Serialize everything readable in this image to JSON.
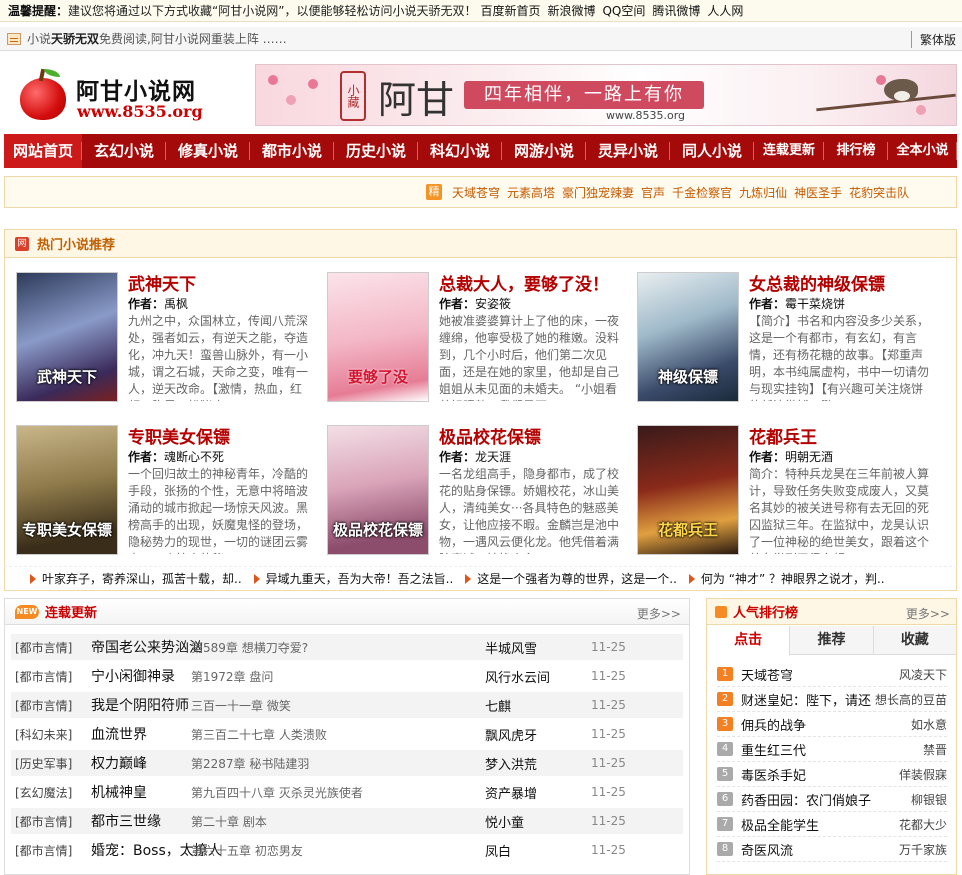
{
  "topbar": {
    "label": "温馨提醒：",
    "text": "建议您将通过以下方式收藏“阿甘小说网”，以便能够轻松访问小说天骄无双！",
    "links": [
      "百度新首页",
      "新浪微博",
      "QQ空间",
      "腾讯微博",
      "人人网"
    ]
  },
  "notice": {
    "prefix": "小说",
    "title": "天骄无双",
    "suffix": "免费阅读,阿甘小说网重装上阵 ……",
    "traditional": "繁体版"
  },
  "header": {
    "site_name": "阿甘小说网",
    "site_url": "www.8535.org",
    "banner_seal": "小藏",
    "banner_big": "阿甘",
    "banner_slogan": "四年相伴，一路上有你",
    "banner_url": "www.8535.org"
  },
  "nav": {
    "items": [
      "网站首页",
      "玄幻小说",
      "修真小说",
      "都市小说",
      "历史小说",
      "科幻小说",
      "网游小说",
      "灵异小说",
      "同人小说",
      "连载更新",
      "排行榜",
      "全本小说"
    ]
  },
  "hotbar": {
    "badge": "精",
    "keywords": [
      "天域苍穹",
      "元素高塔",
      "豪门独宠辣妻",
      "官声",
      "千金检察官",
      "九炼归仙",
      "神医圣手",
      "花豹突击队"
    ]
  },
  "recommend": {
    "title": "热门小说推荐",
    "author_label": "作者：",
    "books": [
      {
        "name": "武神天下",
        "author": "禹枫",
        "cover": "武神天下",
        "desc": "九州之中，众国林立，传闻八荒深处，强者如云，有逆天之能，夺造化，冲九天！蛮兽山脉外，有一小城，谓之石城，天命之变，唯有一人，逆天改命。【激情，热血，红颜，腹黑，扮猪吃..."
      },
      {
        "name": "总裁大人，要够了没！",
        "author": "安姿筱",
        "cover": "要够了没",
        "desc": "她被准婆婆算计上了他的床，一夜缠绵，他寧受极了她的稚嫩。没料到，几个小时后，他们第二次见面，还是在她的家里，他却是自己姐姐从未见面的未婚夫。 “小姐看着好眼熟，我们是不..."
      },
      {
        "name": "女总裁的神级保镖",
        "author": "霉干菜烧饼",
        "cover": "神级保镖",
        "desc": "【简介】书名和内容没多少关系，这是一个有都市，有玄幻，有言情，还有杨花糖的故事。【郑重声明，本书纯属虚构，书中一切请勿与现实挂钩】【有兴趣可关注烧饼的新浪微博，鹏..."
      },
      {
        "name": "专职美女保镖",
        "author": "魂断心不死",
        "cover": "专职美女保镖",
        "desc": "一个回归故土的神秘青年，冷酷的手段，张扬的个性，无意中将暗波涌动的城市掀起一场惊天风波。黑榜高手的出现，妖魔鬼怪的登场，隐秘势力的现世，一切的谜团云雾中，一个惊人的秘..."
      },
      {
        "name": "极品校花保镖",
        "author": "龙天涯",
        "cover": "极品校花保镖",
        "desc": "一名龙组高手，隐身都市，成了校花的贴身保镖。娇媚校花，冰山美人，清纯美女···各具特色的魅惑美女，让他应接不暇。金麟岂是池中物，一遇风云便化龙。他凭借着满腔真诚，婉挨众多..."
      },
      {
        "name": "花都兵王",
        "author": "明朝无酒",
        "cover": "花都兵王",
        "desc": "简介：特种兵龙昊在三年前被人算计，导致任务失败变成废人，又莫名其妙的被关进号称有去无回的死囚监狱三年。在监狱中，龙昊认识了一位神秘的绝世美女，跟着这个美女学到了很多超..."
      }
    ]
  },
  "strip": {
    "items": [
      "叶家弃子，寄养深山，孤苦十载，却..",
      "异域九重天，吾为大帝！吾之法旨..",
      "这是一个强者为尊的世界，这是一个..",
      "何为 “神才” ？神眼界之说才，判.."
    ]
  },
  "updates": {
    "title": "连载更新",
    "badge": "NEW",
    "more": "更多>>",
    "rows": [
      {
        "cat": "[都市言情]",
        "name": "帝国老公来势汹汹",
        "chapter": "第589章 想横刀夺爱?",
        "author": "半城风雪",
        "date": "11-25"
      },
      {
        "cat": "[都市言情]",
        "name": "宁小闲御神录",
        "chapter": "第1972章 盘问",
        "author": "风行水云间",
        "date": "11-25"
      },
      {
        "cat": "[都市言情]",
        "name": "我是个阴阳符师",
        "chapter": "三百一十一章 微笑",
        "author": "七麒",
        "date": "11-25"
      },
      {
        "cat": "[科幻未来]",
        "name": "血流世界",
        "chapter": "第三百二十七章 人类溃败",
        "author": "飘风虎牙",
        "date": "11-25"
      },
      {
        "cat": "[历史军事]",
        "name": "权力巅峰",
        "chapter": "第2287章 秘书陆建羽",
        "author": "梦入洪荒",
        "date": "11-25"
      },
      {
        "cat": "[玄幻魔法]",
        "name": "机械神皇",
        "chapter": "第九百四十八章 灭杀灵光族使者",
        "author": "资产暴增",
        "date": "11-25"
      },
      {
        "cat": "[都市言情]",
        "name": "都市三世缘",
        "chapter": "第二十章 剧本",
        "author": "悦小童",
        "date": "11-25"
      },
      {
        "cat": "[都市言情]",
        "name": "婚宠：Boss，太撩人",
        "chapter": "第六十五章 初恋男友",
        "author": "凤白",
        "date": "11-25"
      }
    ]
  },
  "ranking": {
    "title": "人气排行榜",
    "more": "更多>>",
    "tabs": [
      "点击",
      "推荐",
      "收藏"
    ],
    "rows": [
      {
        "num": "1",
        "name": "天域苍穹",
        "author": "风凌天下"
      },
      {
        "num": "2",
        "name": "财迷皇妃：陛下，请还",
        "author": "想长高的豆苗"
      },
      {
        "num": "3",
        "name": "佣兵的战争",
        "author": "如水意"
      },
      {
        "num": "4",
        "name": "重生红三代",
        "author": "禁晋"
      },
      {
        "num": "5",
        "name": "毒医杀手妃",
        "author": "佯装假寐"
      },
      {
        "num": "6",
        "name": "药香田园：农门俏娘子",
        "author": "柳银银"
      },
      {
        "num": "7",
        "name": "极品全能学生",
        "author": "花都大少"
      },
      {
        "num": "8",
        "name": "奇医风流",
        "author": "万千家族"
      }
    ]
  }
}
